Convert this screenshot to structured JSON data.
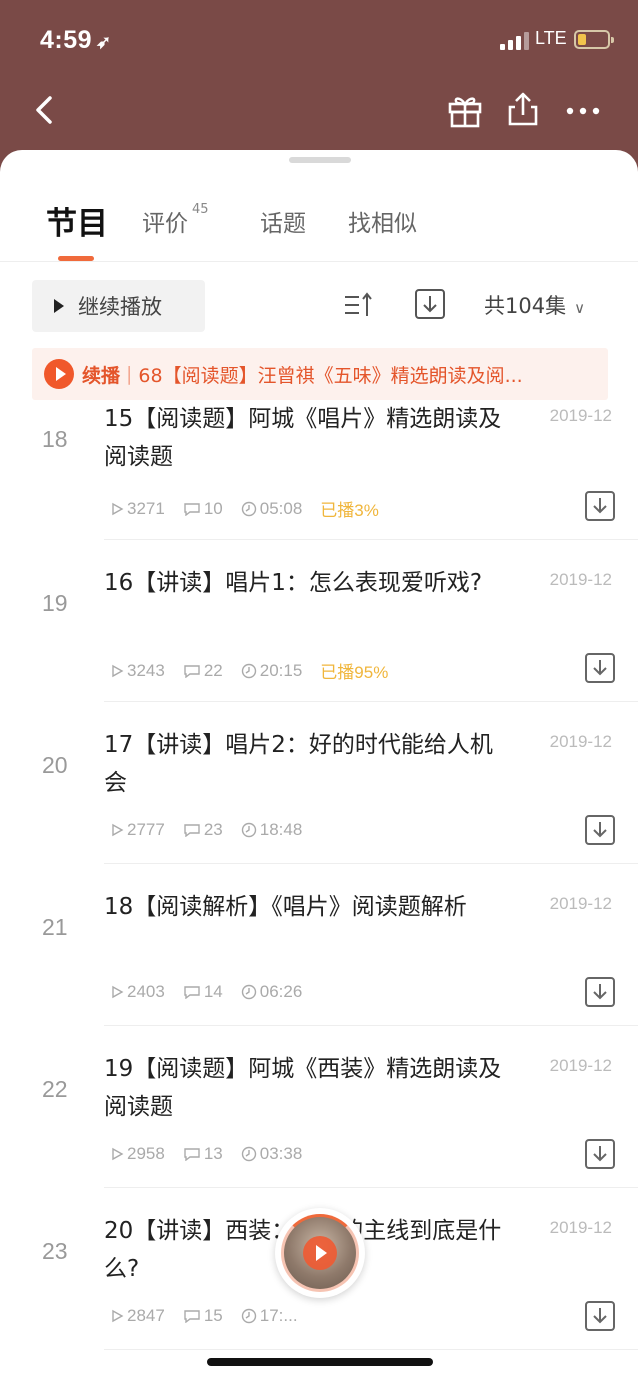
{
  "status_bar": {
    "time": "4:59",
    "network": "LTE"
  },
  "tabs": [
    {
      "label": "节目",
      "active": true
    },
    {
      "label": "评价",
      "count": "45"
    },
    {
      "label": "话题"
    },
    {
      "label": "找相似"
    }
  ],
  "controls": {
    "continue_label": "继续播放",
    "episode_count": "共104集"
  },
  "resume": {
    "label": "续播",
    "title": "68【阅读题】汪曾祺《五味》精选朗读及阅..."
  },
  "episodes": [
    {
      "index": "18",
      "title": "15【阅读题】阿城《唱片》精选朗读及阅读题",
      "date": "2019-12",
      "plays": "3271",
      "comments": "10",
      "duration": "05:08",
      "played": "已播3%"
    },
    {
      "index": "19",
      "title": "16【讲读】唱片1：怎么表现爱听戏?",
      "date": "2019-12",
      "plays": "3243",
      "comments": "22",
      "duration": "20:15",
      "played": "已播95%"
    },
    {
      "index": "20",
      "title": "17【讲读】唱片2：好的时代能给人机会",
      "date": "2019-12",
      "plays": "2777",
      "comments": "23",
      "duration": "18:48",
      "played": ""
    },
    {
      "index": "21",
      "title": "18【阅读解析】《唱片》阅读题解析",
      "date": "2019-12",
      "plays": "2403",
      "comments": "14",
      "duration": "06:26",
      "played": ""
    },
    {
      "index": "22",
      "title": "19【阅读题】阿城《西装》精选朗读及阅读题",
      "date": "2019-12",
      "plays": "2958",
      "comments": "13",
      "duration": "03:38",
      "played": ""
    },
    {
      "index": "23",
      "title": "20【讲读】西装：故事的主线到底是什么?",
      "date": "2019-12",
      "plays": "2847",
      "comments": "15",
      "duration": "17:...",
      "played": ""
    }
  ],
  "colors": {
    "header_bg": "#7a4a47",
    "accent": "#f06a3b",
    "played": "#f0b63c"
  }
}
